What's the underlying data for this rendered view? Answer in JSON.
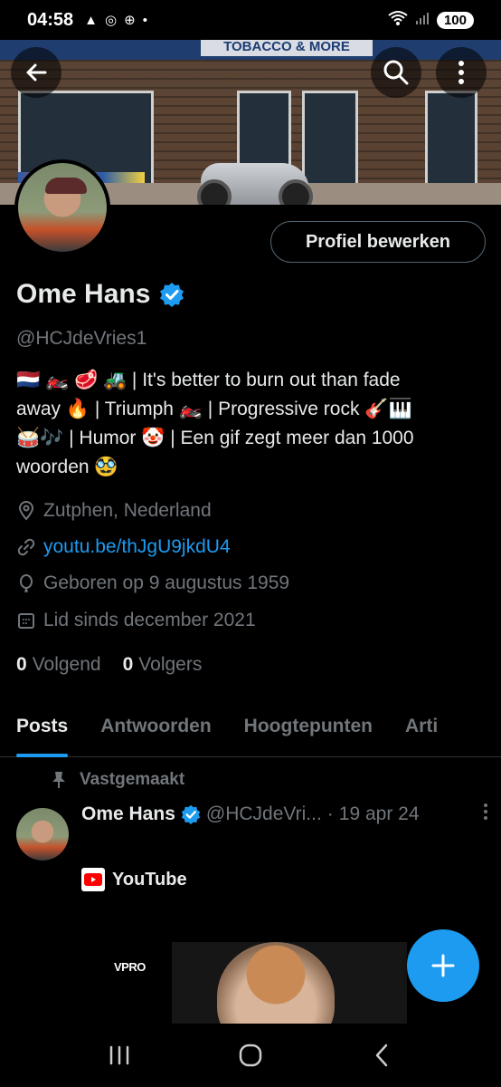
{
  "status_bar": {
    "time": "04:58",
    "battery": "100"
  },
  "banner": {
    "sign_text": "TOBACCO & MORE"
  },
  "profile": {
    "edit_button_label": "Profiel bewerken",
    "name": "Ome Hans",
    "handle": "@HCJdeVries1",
    "bio_line1": "🇳🇱 🏍️ 🥩 🚜 | It's better to burn out than fade",
    "bio_line2": "away 🔥 | Triumph 🏍️ | Progressive rock 🎸🎹",
    "bio_line3": "🥁🎶 | Humor 🤡 | Een gif zegt meer dan 1000",
    "bio_line4": "woorden 🥸",
    "location": "Zutphen, Nederland",
    "link": "youtu.be/thJgU9jkdU4",
    "birthday": "Geboren op 9 augustus 1959",
    "joined": "Lid sinds december 2021",
    "following_count": "0",
    "following_label": "Volgend",
    "followers_count": "0",
    "followers_label": "Volgers"
  },
  "tabs": [
    "Posts",
    "Antwoorden",
    "Hoogtepunten",
    "Arti"
  ],
  "post": {
    "pinned_label": "Vastgemaakt",
    "author_name": "Ome Hans",
    "author_handle": "@HCJdeVri...",
    "separator": "·",
    "date": "19 apr 24",
    "card_source": "YouTube",
    "media_watermark": "VPRO"
  },
  "colors": {
    "accent": "#1d9bf0",
    "muted": "#71767b",
    "text": "#e7e9ea",
    "background": "#000000"
  },
  "icons": [
    "back-arrow-icon",
    "search-icon",
    "more-vertical-icon",
    "verified-badge-icon",
    "location-pin-icon",
    "link-icon",
    "balloon-icon",
    "calendar-icon",
    "pin-icon",
    "youtube-icon",
    "plus-icon",
    "recents-icon",
    "home-icon",
    "back-nav-icon"
  ]
}
